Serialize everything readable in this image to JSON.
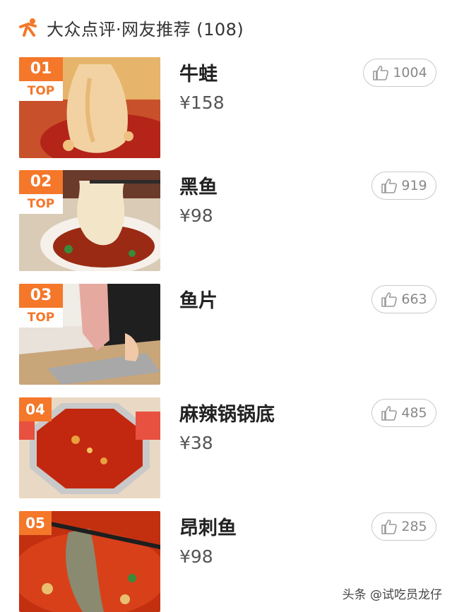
{
  "header": {
    "logo_icon": "dianping-logo-icon",
    "title": "大众点评·网友推荐 (108)"
  },
  "accent_color": "#f4772a",
  "items": [
    {
      "rank": "01",
      "top_badge": "TOP",
      "name": "牛蛙",
      "price": "¥158",
      "likes": "1004",
      "image": "frog-hotpot-photo"
    },
    {
      "rank": "02",
      "top_badge": "TOP",
      "name": "黑鱼",
      "price": "¥98",
      "likes": "919",
      "image": "blackfish-photo"
    },
    {
      "rank": "03",
      "top_badge": "TOP",
      "name": "鱼片",
      "price": "",
      "likes": "663",
      "image": "fish-slicing-photo"
    },
    {
      "rank": "04",
      "top_badge": "",
      "name": "麻辣锅锅底",
      "price": "¥38",
      "likes": "485",
      "image": "spicy-hotpot-base-photo"
    },
    {
      "rank": "05",
      "top_badge": "",
      "name": "昂刺鱼",
      "price": "¥98",
      "likes": "285",
      "image": "yellow-catfish-photo"
    }
  ],
  "watermark": "头条 @试吃员龙仔"
}
